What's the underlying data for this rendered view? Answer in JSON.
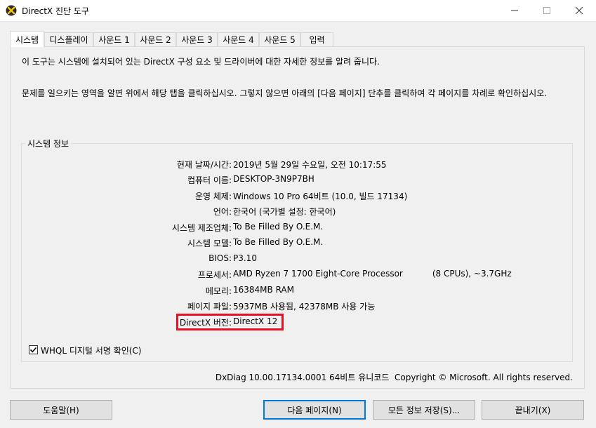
{
  "window": {
    "title": "DirectX 진단 도구",
    "minimize_icon": "minimize-icon",
    "maximize_icon": "maximize-icon",
    "close_icon": "close-icon",
    "app_icon": "directx-icon"
  },
  "tabs": [
    {
      "label": "시스템",
      "active": true
    },
    {
      "label": "디스플레이"
    },
    {
      "label": "사운드 1"
    },
    {
      "label": "사운드 2"
    },
    {
      "label": "사운드 3"
    },
    {
      "label": "사운드 4"
    },
    {
      "label": "사운드 5"
    },
    {
      "label": "입력"
    }
  ],
  "intro": {
    "line1": "이 도구는 시스템에 설치되어 있는 DirectX 구성 요소 및 드라이버에 대한 자세한 정보를 알려 줍니다.",
    "line2": "문제를 일으키는 영역을 알면 위에서 해당 탭을 클릭하십시오. 그렇지 않으면 아래의 [다음 페이지] 단추를 클릭하여 각 페이지를 차례로 확인하십시오."
  },
  "system_info": {
    "group_title": "시스템 정보",
    "rows": [
      {
        "label": "현재 날짜/시간:",
        "value": "2019년 5월 29일 수요일, 오전 10:17:55"
      },
      {
        "label": "컴퓨터 이름:",
        "value": "DESKTOP-3N9P7BH"
      },
      {
        "label": "운영 체제:",
        "value": "Windows 10 Pro 64비트 (10.0, 빌드 17134)"
      },
      {
        "label": "언어:",
        "value": "한국어 (국가별 설정: 한국어)"
      },
      {
        "label": "시스템 제조업체:",
        "value": "To Be Filled By O.E.M."
      },
      {
        "label": "시스템 모델:",
        "value": "To Be Filled By O.E.M."
      },
      {
        "label": "BIOS:",
        "value": "P3.10"
      },
      {
        "label": "프로세서:",
        "value": "AMD Ryzen 7 1700 Eight-Core Processor           (8 CPUs), ~3.7GHz"
      },
      {
        "label": "메모리:",
        "value": "16384MB RAM"
      },
      {
        "label": "페이지 파일:",
        "value": "5937MB 사용됨, 42378MB 사용 가능"
      },
      {
        "label": "DirectX 버전:",
        "value": "DirectX 12"
      }
    ]
  },
  "whql": {
    "label": "WHQL 디지털 서명 확인(C)",
    "checked": true
  },
  "footer": {
    "version_text": "DxDiag 10.00.17134.0001 64비트 유니코드  Copyright © Microsoft. All rights reserved."
  },
  "buttons": {
    "help": "도움말(H)",
    "next_page": "다음 페이지(N)",
    "save_all": "모든 정보 저장(S)...",
    "exit": "끝내기(X)"
  },
  "colors": {
    "highlight": "#e81123",
    "accent": "#0078d7"
  }
}
